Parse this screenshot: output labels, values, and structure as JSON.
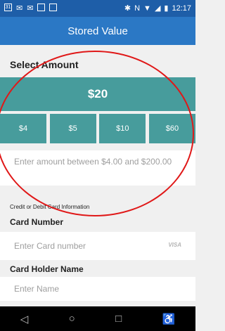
{
  "status_bar": {
    "left_icons": [
      "notification-icon",
      "email-icon",
      "email-icon",
      "image-icon",
      "image-icon"
    ],
    "right_icons": [
      "bluetooth-icon",
      "nfc-icon",
      "wifi-icon",
      "signal-icon",
      "battery-icon"
    ],
    "time": "12:17"
  },
  "header": {
    "title": "Stored Value"
  },
  "select_amount": {
    "title": "Select Amount",
    "selected": "$20",
    "options": [
      "$4",
      "$5",
      "$10",
      "$60"
    ],
    "input_placeholder": "Enter amount between $4.00 and $200.00"
  },
  "card_info": {
    "section_label": "Credit or Debit Card Information",
    "card_number_label": "Card Number",
    "card_number_placeholder": "Enter Card number",
    "card_brand": "VISA",
    "card_holder_label": "Card Holder Name",
    "card_holder_placeholder": "Enter Name"
  },
  "nav": {
    "icons": [
      "back-icon",
      "home-icon",
      "recents-icon",
      "accessibility-icon"
    ]
  },
  "colors": {
    "accent": "#479c9c",
    "header": "#2b78c5",
    "statusbar": "#1e5ea8",
    "annotation": "#e01818"
  }
}
